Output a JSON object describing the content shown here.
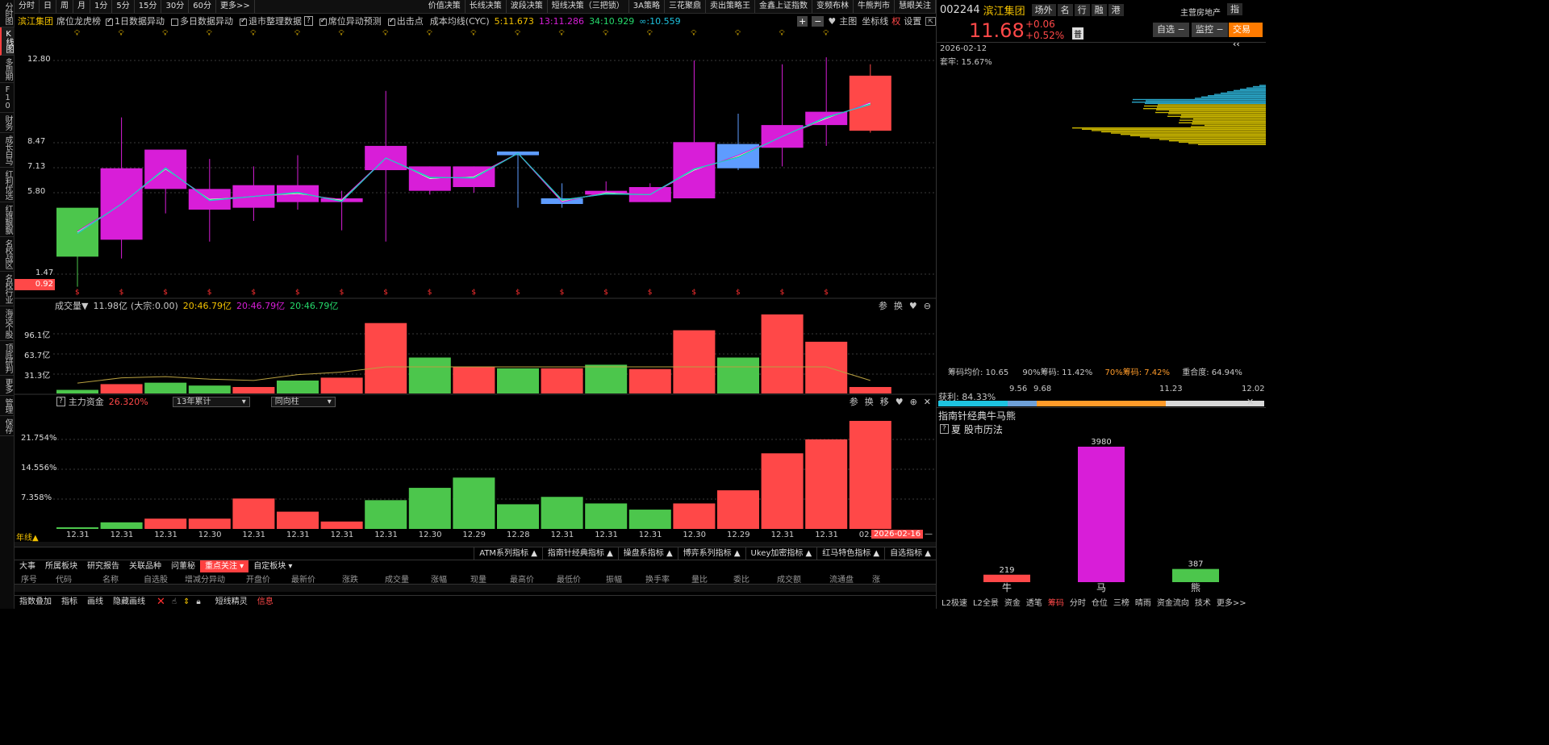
{
  "leftnav": [
    "分时图",
    "K线图",
    "多周期",
    "F10",
    "财务",
    "成长白马",
    "红利优选",
    "红旗飘飘",
    "名校战区",
    "名校行业",
    "海选个股",
    "顶底研判",
    "更多",
    "管理",
    "保存"
  ],
  "toolbar": {
    "periods": [
      "分时",
      "日",
      "周",
      "月",
      "1分",
      "5分",
      "15分",
      "30分",
      "60分",
      "更多>>"
    ],
    "strategies": [
      "价值决策",
      "长线决策",
      "波段决策",
      "短线决策（三把锁）",
      "3A策略",
      "三花聚鼎",
      "卖出策略王",
      "金鑫上证指数",
      "变频布林",
      "牛熊判市",
      "慧眼关注"
    ]
  },
  "info": {
    "stock_name": "滨江集团",
    "board": "席位龙虎榜",
    "opt1": "1日数据异动",
    "opt2": "多日数据异动",
    "opt3": "退市整理数据",
    "opt4": "席位异动预测",
    "opt5": "出击点",
    "cost_label": "成本均线(CYC)",
    "ma5": "5:11.673",
    "ma13": "13:11.286",
    "ma34": "34:10.929",
    "ma_inf": "∞:10.559",
    "main_btn": "主图",
    "coord_btn": "坐标线",
    "quan": "权",
    "settings": "设置"
  },
  "price_axis": {
    "labels": [
      "12.80",
      "8.47",
      "7.13",
      "5.80",
      "1.47"
    ],
    "current": "0.92"
  },
  "volume": {
    "title": "成交量▼",
    "total": "11.98亿",
    "dazong": "(大宗:0.00)",
    "v1": "20:46.79亿",
    "v2": "20:46.79亿",
    "v3": "20:46.79亿",
    "axis": [
      "96.1亿",
      "63.7亿",
      "31.3亿"
    ],
    "icons": [
      "参",
      "换"
    ]
  },
  "capital": {
    "title": "主力资金",
    "pct": "26.320%",
    "sel1": "13年累计",
    "sel2": "同向柱",
    "axis": [
      "21.754%",
      "14.556%",
      "7.358%"
    ],
    "icons": [
      "参",
      "换",
      "移"
    ]
  },
  "dates": {
    "cycle": "年线▲",
    "labels": [
      "12.31",
      "12.31",
      "12.31",
      "12.30",
      "12.31",
      "12.31",
      "12.31",
      "12.31",
      "12.30",
      "12.29",
      "12.28",
      "12.31",
      "12.31",
      "12.31",
      "12.30",
      "12.29",
      "12.31",
      "12.31",
      "02."
    ],
    "current": "2026-02-16"
  },
  "indicators": [
    "ATM系列指标 ▲",
    "指南针经典指标 ▲",
    "操盘系指标 ▲",
    "博弈系列指标 ▲",
    "Ukey加密指标 ▲",
    "红马特色指标 ▲",
    "自选指标 ▲"
  ],
  "bottom_tabs": [
    "大事",
    "所属板块",
    "研究报告",
    "关联品种",
    "问董秘",
    "重点关注 ▾",
    "自定板块 ▾"
  ],
  "table_headers": [
    "序号",
    "代码",
    "名称",
    "自选股",
    "增减分异动",
    "开盘价",
    "最新价",
    "涨跌",
    "成交量",
    "涨幅",
    "现量",
    "最高价",
    "最低价",
    "振幅",
    "换手率",
    "量比",
    "委比",
    "成交额",
    "流通盘",
    "涨"
  ],
  "footer": {
    "items": [
      "指数叠加",
      "指标",
      "画线",
      "隐藏画线"
    ],
    "short": "短线精灵",
    "msg": "信息"
  },
  "right": {
    "code": "002244",
    "name": "滨江集团",
    "btns": [
      "场外",
      "名",
      "行",
      "融",
      "港"
    ],
    "sector": "主营房地产",
    "zhi": "指",
    "price": "11.68",
    "chg": "+0.06",
    "pct": "+0.52%",
    "fu": "普",
    "zixuan": "自选 −",
    "jiankong": "监控 −",
    "jiaoyi": "交易 ‹‹",
    "date": "2026-02-12",
    "taolao": "套牢: 15.67%",
    "avg": "筹码均价: 10.65",
    "c90": "90%筹码: 11.42%",
    "c70": "70%筹码: 7.42%",
    "overlap": "重合度: 64.94%",
    "profit": "获利: 84.33%",
    "scale": [
      "9.56",
      "9.68",
      "11.23",
      "12.02"
    ],
    "section": "指南针经典牛马熊",
    "calendar": "夏 股市历法",
    "bars": [
      {
        "label": "牛",
        "value": "219"
      },
      {
        "label": "马",
        "value": "3980"
      },
      {
        "label": "熊",
        "value": "387"
      }
    ],
    "bottom": [
      "L2极速",
      "L2全景",
      "资金",
      "透笔",
      "筹码",
      "分时",
      "仓位",
      "三榜",
      "晴雨",
      "资金流向",
      "技术",
      "更多>>"
    ]
  },
  "colors": {
    "up": "#d81ed8",
    "down": "#5e9cff",
    "red": "#ff4848",
    "green": "#4cc64c",
    "yellow": "#f2c100"
  },
  "chart_data": [
    {
      "type": "candlestick",
      "title": "滨江集团",
      "ylabel": "",
      "yticks": [
        12.8,
        8.47,
        7.13,
        5.8,
        1.47
      ],
      "ylim": [
        0.6,
        13.6
      ],
      "candles": [
        [
          2.4,
          5.0,
          4.1,
          0.8
        ],
        [
          3.3,
          7.1,
          9.8,
          2.3
        ],
        [
          6.0,
          8.1,
          7.2,
          4.7
        ],
        [
          4.9,
          6.0,
          7.6,
          3.2
        ],
        [
          5.0,
          6.2,
          7.2,
          4.3
        ],
        [
          5.3,
          6.2,
          7.8,
          4.9
        ],
        [
          5.3,
          5.5,
          5.9,
          3.8
        ],
        [
          7.0,
          8.3,
          11.2,
          3.2
        ],
        [
          5.9,
          7.2,
          7.2,
          5.7
        ],
        [
          6.1,
          7.2,
          7.2,
          5.8
        ],
        [
          8.0,
          7.8,
          8.0,
          5.0
        ],
        [
          5.5,
          5.2,
          6.3,
          5.0
        ],
        [
          5.7,
          5.9,
          6.4,
          5.7
        ],
        [
          5.3,
          6.1,
          6.3,
          5.3
        ],
        [
          5.5,
          8.5,
          12.8,
          5.5
        ],
        [
          8.4,
          7.1,
          10.0,
          7.0
        ],
        [
          8.2,
          9.4,
          12.6,
          7.2
        ],
        [
          9.4,
          10.1,
          13.0,
          8.3
        ],
        [
          9.1,
          12.0,
          12.6,
          9.0
        ]
      ],
      "ma_colors": [
        "#f5f5f5",
        "#f2c100",
        "#d81ed8",
        "#25d96b",
        "#1ec3e0"
      ]
    },
    {
      "type": "bar",
      "title": "成交量",
      "ylim": [
        0,
        120
      ],
      "values": [
        5,
        13,
        15,
        11,
        9,
        18,
        22,
        98,
        50,
        37,
        35,
        35,
        40,
        34,
        88,
        50,
        110,
        72,
        9
      ]
    },
    {
      "type": "bar",
      "title": "主力资金",
      "ylim": [
        0,
        28
      ],
      "values": [
        0.4,
        1.6,
        2.5,
        2.5,
        7.4,
        4.2,
        1.8,
        7.0,
        10.0,
        12.5,
        6.0,
        7.8,
        6.2,
        4.7,
        6.2,
        9.4,
        18.4,
        21.8,
        26.3
      ]
    },
    {
      "type": "bar",
      "title": "指南针经典牛马熊",
      "categories": [
        "牛",
        "马",
        "熊"
      ],
      "values": [
        219,
        3980,
        387
      ]
    }
  ]
}
